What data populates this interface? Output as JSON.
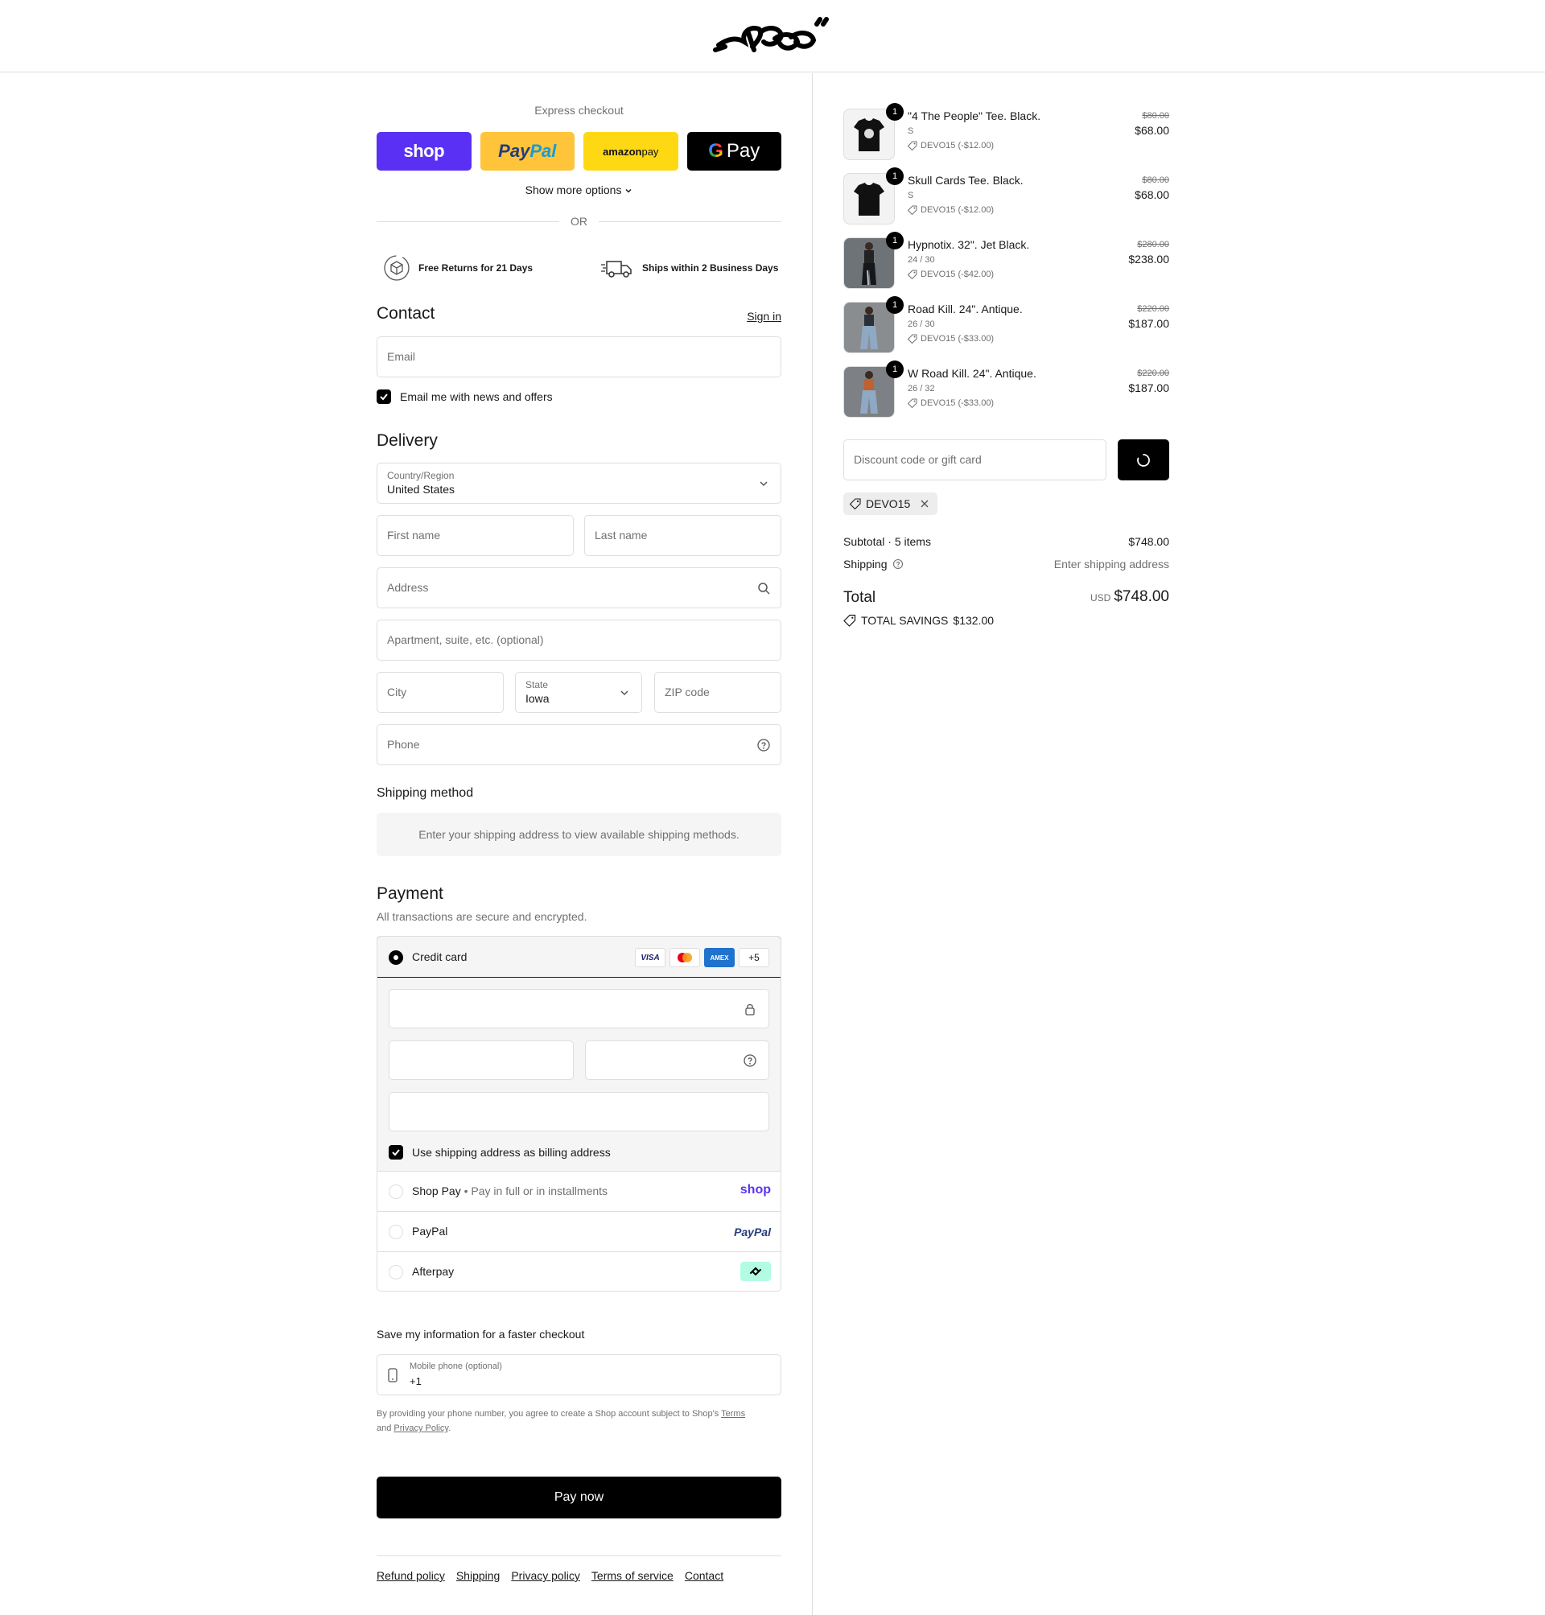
{
  "express": {
    "title": "Express checkout",
    "shop_label": "shop",
    "paypal_a": "Pay",
    "paypal_b": "Pal",
    "amazon_a": "amazon",
    "amazon_b": " pay",
    "gpay_label": "Pay",
    "more_options": "Show more options",
    "or": "OR"
  },
  "perks": {
    "returns": "Free Returns for 21 Days",
    "shipping": "Ships within 2 Business Days"
  },
  "contact": {
    "title": "Contact",
    "sign_in": "Sign in",
    "email_placeholder": "Email",
    "news_label": "Email me with news and offers",
    "news_checked": true
  },
  "delivery": {
    "title": "Delivery",
    "country_label": "Country/Region",
    "country_value": "United States",
    "first_name": "First name",
    "last_name": "Last name",
    "address": "Address",
    "apartment": "Apartment, suite, etc. (optional)",
    "city": "City",
    "state_label": "State",
    "state_value": "Iowa",
    "zip": "ZIP code",
    "phone": "Phone"
  },
  "shipping_method": {
    "title": "Shipping method",
    "message": "Enter your shipping address to view available shipping methods."
  },
  "payment": {
    "title": "Payment",
    "subtitle": "All transactions are secure and encrypted.",
    "credit_card": "Credit card",
    "badges": [
      "VISA",
      "",
      "AMEX",
      "+5"
    ],
    "billing_label": "Use shipping address as billing address",
    "shop_pay": "Shop Pay",
    "shop_pay_sub": "Pay in full or in installments",
    "shop_pay_brand": "shop",
    "paypal": "PayPal",
    "paypal_brand": "PayPal",
    "afterpay": "Afterpay"
  },
  "save_info": {
    "title": "Save my information for a faster checkout",
    "phone_label": "Mobile phone (optional)",
    "phone_value": "+1",
    "legal_a": "By providing your phone number, you agree to create a Shop account subject to Shop's ",
    "terms": "Terms",
    "legal_b": "and ",
    "privacy": "Privacy Policy",
    "legal_c": "."
  },
  "pay_now": "Pay now",
  "footer": [
    "Refund policy",
    "Shipping",
    "Privacy policy",
    "Terms of service",
    "Contact"
  ],
  "summary": {
    "items": [
      {
        "qty": "1",
        "name": "\"4 The People\" Tee. Black.",
        "variant": "S",
        "discount": "DEVO15 (-$12.00)",
        "original": "$80.00",
        "price": "$68.00"
      },
      {
        "qty": "1",
        "name": "Skull Cards Tee. Black.",
        "variant": "S",
        "discount": "DEVO15 (-$12.00)",
        "original": "$80.00",
        "price": "$68.00"
      },
      {
        "qty": "1",
        "name": "Hypnotix. 32\". Jet Black.",
        "variant": "24 / 30",
        "discount": "DEVO15 (-$42.00)",
        "original": "$280.00",
        "price": "$238.00"
      },
      {
        "qty": "1",
        "name": "Road Kill. 24\". Antique.",
        "variant": "26 / 30",
        "discount": "DEVO15 (-$33.00)",
        "original": "$220.00",
        "price": "$187.00"
      },
      {
        "qty": "1",
        "name": "W Road Kill. 24\". Antique.",
        "variant": "26 / 32",
        "discount": "DEVO15 (-$33.00)",
        "original": "$220.00",
        "price": "$187.00"
      }
    ],
    "discount_placeholder": "Discount code or gift card",
    "applied_code": "DEVO15",
    "subtotal_label": "Subtotal · 5 items",
    "subtotal_value": "$748.00",
    "shipping_label": "Shipping",
    "shipping_value": "Enter shipping address",
    "total_label": "Total",
    "currency": "USD",
    "total_value": "$748.00",
    "savings_label": "TOTAL SAVINGS",
    "savings_value": "$132.00"
  },
  "colors": {
    "shop_purple": "#5a31f4",
    "paypal_yellow": "#ffc439",
    "amazon_yellow": "#ffd814",
    "afterpay_mint": "#b2fce4",
    "border": "#dedede",
    "muted_text": "#707070"
  }
}
